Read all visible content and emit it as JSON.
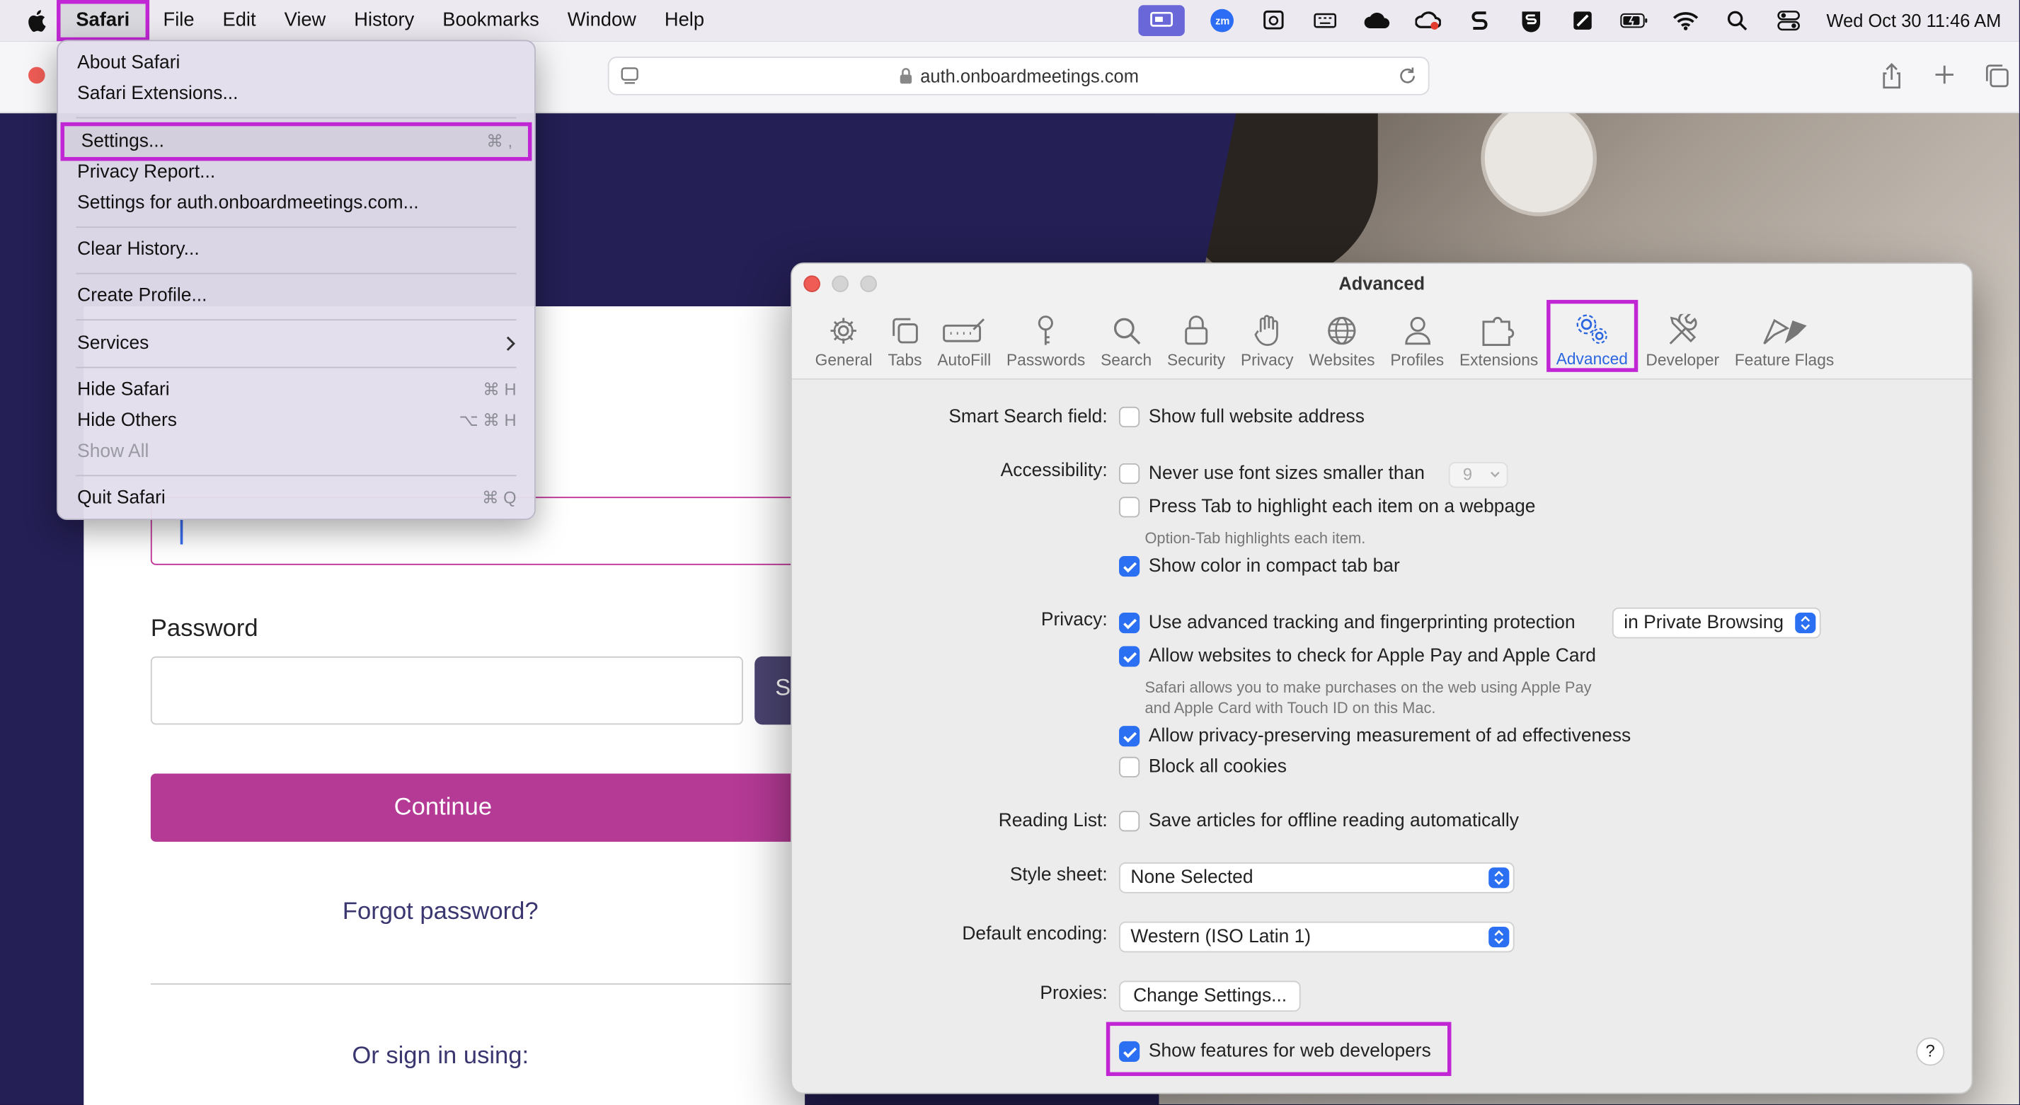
{
  "menubar": {
    "items": [
      "Safari",
      "File",
      "Edit",
      "View",
      "History",
      "Bookmarks",
      "Window",
      "Help"
    ],
    "clock": "Wed Oct 30  11:46 AM",
    "status_icons": [
      "screen-share-icon",
      "zoom-icon",
      "display-icon",
      "keyboard-icon",
      "cloud-icon",
      "creative-cloud-icon",
      "s-app-icon",
      "shield-s-icon",
      "note-app-icon",
      "battery-icon",
      "wifi-icon",
      "search-icon",
      "control-center-icon"
    ],
    "zoom_badge": "zm"
  },
  "browser": {
    "url": "auth.onboardmeetings.com"
  },
  "safari_menu": {
    "items": [
      {
        "label": "About Safari",
        "shortcut": ""
      },
      {
        "label": "Safari Extensions...",
        "shortcut": ""
      },
      {
        "label": "Settings...",
        "shortcut": "⌘ ,"
      },
      {
        "label": "Privacy Report...",
        "shortcut": ""
      },
      {
        "label": "Settings for auth.onboardmeetings.com...",
        "shortcut": ""
      },
      {
        "label": "Clear History...",
        "shortcut": ""
      },
      {
        "label": "Create Profile...",
        "shortcut": ""
      },
      {
        "label": "Services",
        "shortcut": ""
      },
      {
        "label": "Hide Safari",
        "shortcut": "⌘ H"
      },
      {
        "label": "Hide Others",
        "shortcut": "⌥ ⌘ H"
      },
      {
        "label": "Show All",
        "shortcut": ""
      },
      {
        "label": "Quit Safari",
        "shortcut": "⌘ Q"
      }
    ]
  },
  "login": {
    "password_label": "Password",
    "show_button_partial": "S",
    "continue_label": "Continue",
    "forgot_label": "Forgot password?",
    "or_sign_in": "Or sign in using:"
  },
  "settings": {
    "title": "Advanced",
    "tabs": [
      "General",
      "Tabs",
      "AutoFill",
      "Passwords",
      "Search",
      "Security",
      "Privacy",
      "Websites",
      "Profiles",
      "Extensions",
      "Advanced",
      "Developer",
      "Feature Flags"
    ],
    "selected_tab": "Advanced",
    "smart_search_label": "Smart Search field:",
    "show_full_address": "Show full website address",
    "accessibility_label": "Accessibility:",
    "never_font_size": "Never use font sizes smaller than",
    "font_size_value": "9",
    "press_tab": "Press Tab to highlight each item on a webpage",
    "option_tab_hint": "Option-Tab highlights each item.",
    "show_color_tabbar": "Show color in compact tab bar",
    "privacy_label": "Privacy:",
    "advanced_tracking": "Use advanced tracking and fingerprinting protection",
    "tracking_mode": "in Private Browsing",
    "apple_pay": "Allow websites to check for Apple Pay and Apple Card",
    "apple_pay_hint_1": "Safari allows you to make purchases on the web using Apple Pay",
    "apple_pay_hint_2": "and Apple Card with Touch ID on this Mac.",
    "ad_measurement": "Allow privacy-preserving measurement of ad effectiveness",
    "block_cookies": "Block all cookies",
    "reading_list_label": "Reading List:",
    "save_articles": "Save articles for offline reading automatically",
    "style_sheet_label": "Style sheet:",
    "style_sheet_value": "None Selected",
    "encoding_label": "Default encoding:",
    "encoding_value": "Western (ISO Latin 1)",
    "proxies_label": "Proxies:",
    "change_settings": "Change Settings...",
    "web_dev_features": "Show features for web developers",
    "help": "?",
    "checks": {
      "show_full_address": false,
      "never_font_size": false,
      "press_tab": false,
      "show_color_tabbar": true,
      "advanced_tracking": true,
      "apple_pay": true,
      "ad_measurement": true,
      "block_cookies": false,
      "save_articles": false,
      "web_dev_features": true
    }
  },
  "colors": {
    "highlight": "#c026d3",
    "accent": "#2b6ff2",
    "continue_button": "#b43a95",
    "page_background": "#241f54"
  }
}
